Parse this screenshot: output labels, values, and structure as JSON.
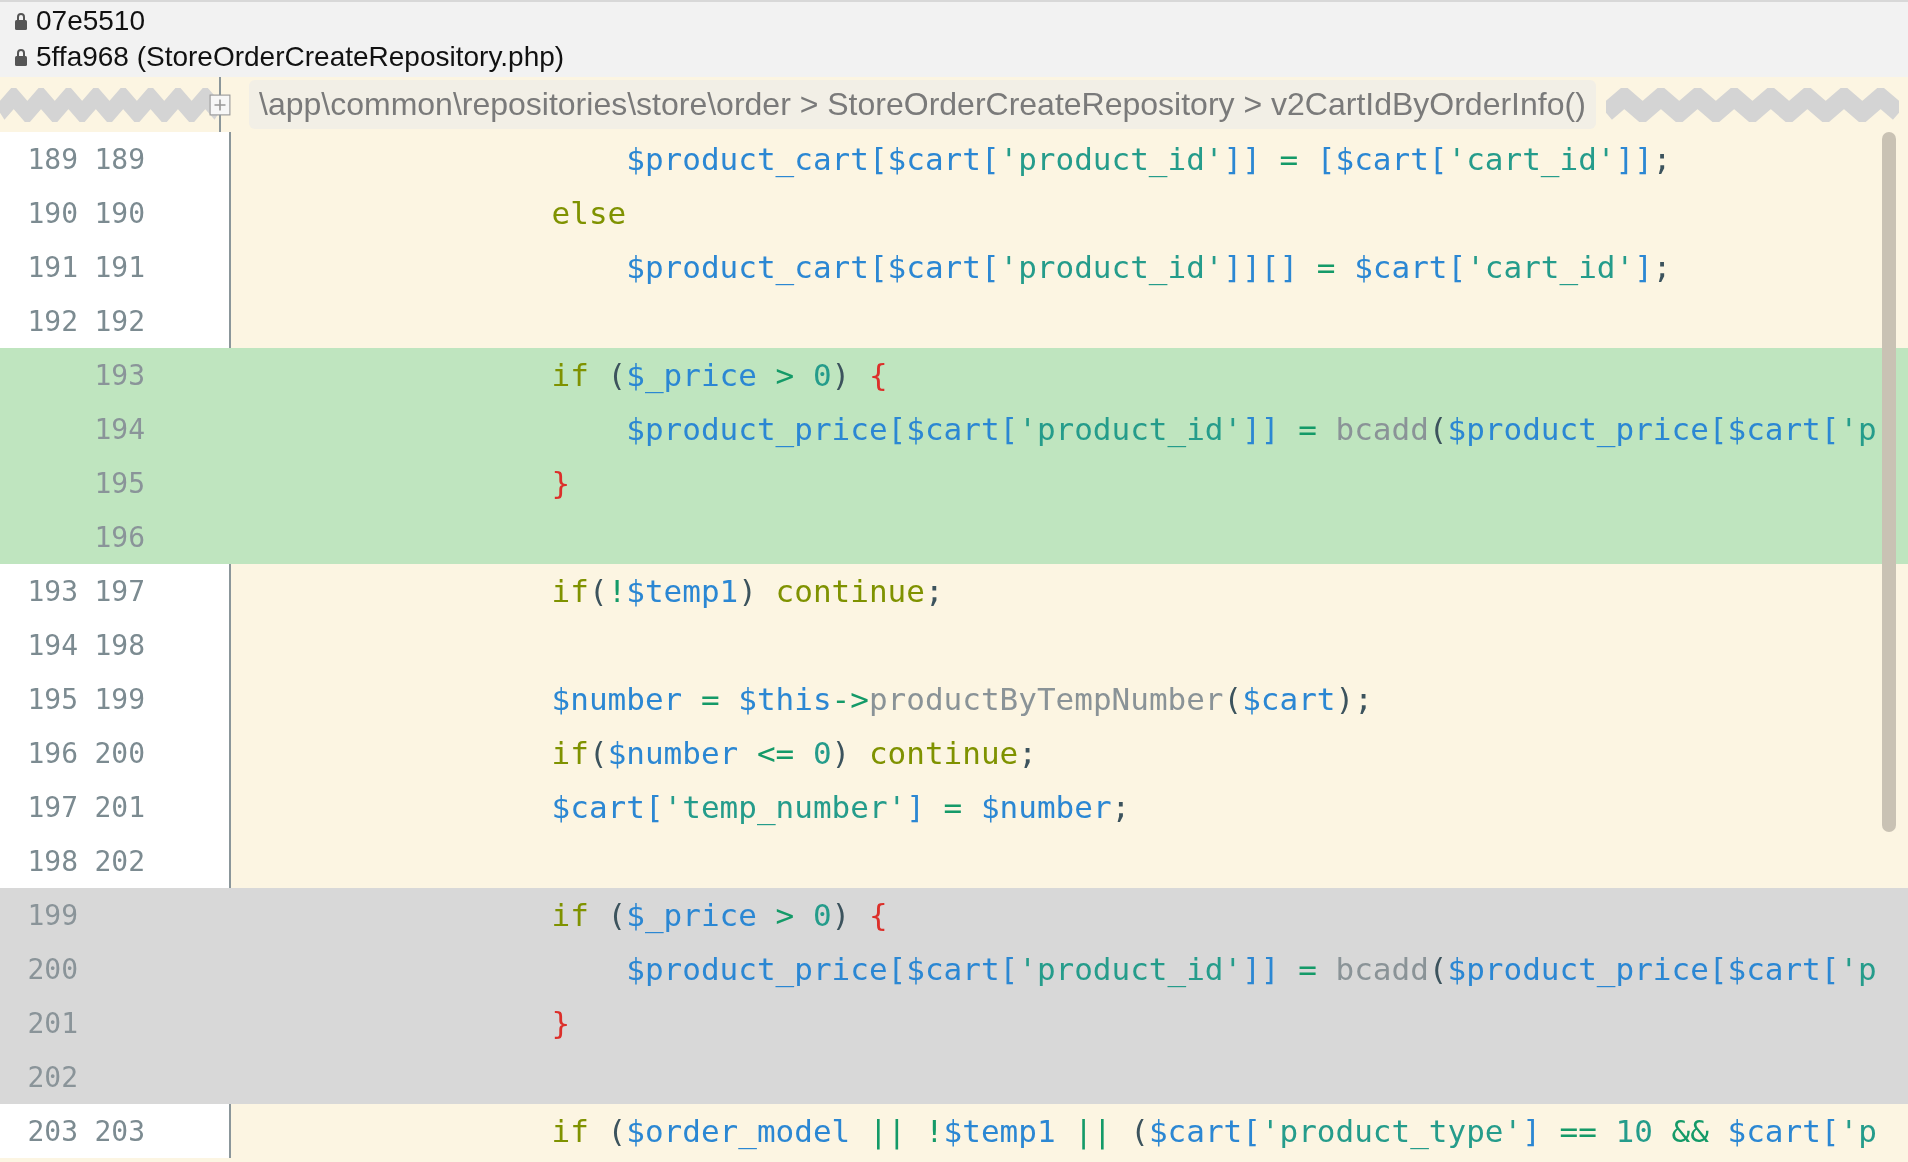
{
  "revisions": [
    {
      "text": "07e5510"
    },
    {
      "text": "5ffa968 (StoreOrderCreateRepository.php)"
    }
  ],
  "breadcrumb": "\\app\\common\\repositories\\store\\order > StoreOrderCreateRepository > v2CartIdByOrderInfo()",
  "lines": [
    {
      "kind": "context",
      "old": "189",
      "new": "189",
      "tokens": [
        {
          "text": "                    $product_cart[$cart[",
          "kind": "var"
        },
        {
          "text": "'product_id'",
          "kind": "str"
        },
        {
          "text": "]]",
          "kind": "var"
        },
        {
          "text": " = ",
          "kind": "op"
        },
        {
          "text": "[$cart[",
          "kind": "var"
        },
        {
          "text": "'cart_id'",
          "kind": "str"
        },
        {
          "text": "]]",
          "kind": "var"
        },
        {
          "text": ";",
          "kind": "punct"
        }
      ]
    },
    {
      "kind": "context",
      "old": "190",
      "new": "190",
      "tokens": [
        {
          "text": "                else",
          "kind": "kw"
        }
      ]
    },
    {
      "kind": "context",
      "old": "191",
      "new": "191",
      "tokens": [
        {
          "text": "                    $product_cart[$cart[",
          "kind": "var"
        },
        {
          "text": "'product_id'",
          "kind": "str"
        },
        {
          "text": "]][]",
          "kind": "var"
        },
        {
          "text": " = ",
          "kind": "op"
        },
        {
          "text": "$cart[",
          "kind": "var"
        },
        {
          "text": "'cart_id'",
          "kind": "str"
        },
        {
          "text": "]",
          "kind": "var"
        },
        {
          "text": ";",
          "kind": "punct"
        }
      ]
    },
    {
      "kind": "context",
      "old": "192",
      "new": "192"
    },
    {
      "kind": "added",
      "new": "193",
      "tokens": [
        {
          "text": "                if",
          "kind": "kw"
        },
        {
          "text": " (",
          "kind": "punct"
        },
        {
          "text": "$_price",
          "kind": "var"
        },
        {
          "text": " > ",
          "kind": "op"
        },
        {
          "text": "0",
          "kind": "num"
        },
        {
          "text": ") ",
          "kind": "punct"
        },
        {
          "text": "{",
          "kind": "brace"
        }
      ]
    },
    {
      "kind": "added",
      "new": "194",
      "tokens": [
        {
          "text": "                    $product_price[$cart[",
          "kind": "var"
        },
        {
          "text": "'product_id'",
          "kind": "str"
        },
        {
          "text": "]]",
          "kind": "var"
        },
        {
          "text": " = ",
          "kind": "op"
        },
        {
          "text": "bcadd",
          "kind": "fn"
        },
        {
          "text": "(",
          "kind": "punct"
        },
        {
          "text": "$product_price[$cart[",
          "kind": "var"
        },
        {
          "text": "'p",
          "kind": "str"
        }
      ]
    },
    {
      "kind": "added",
      "new": "195",
      "tokens": [
        {
          "text": "                }",
          "kind": "brace"
        }
      ]
    },
    {
      "kind": "added",
      "new": "196"
    },
    {
      "kind": "context",
      "old": "193",
      "new": "197",
      "tokens": [
        {
          "text": "                if",
          "kind": "kw"
        },
        {
          "text": "(",
          "kind": "punct"
        },
        {
          "text": "!",
          "kind": "op"
        },
        {
          "text": "$temp1",
          "kind": "var"
        },
        {
          "text": ") ",
          "kind": "punct"
        },
        {
          "text": "continue",
          "kind": "kw"
        },
        {
          "text": ";",
          "kind": "punct"
        }
      ]
    },
    {
      "kind": "context",
      "old": "194",
      "new": "198"
    },
    {
      "kind": "context",
      "old": "195",
      "new": "199",
      "tokens": [
        {
          "text": "                $number",
          "kind": "var"
        },
        {
          "text": " = ",
          "kind": "op"
        },
        {
          "text": "$this",
          "kind": "var"
        },
        {
          "text": "->",
          "kind": "op"
        },
        {
          "text": "productByTempNumber",
          "kind": "fn"
        },
        {
          "text": "(",
          "kind": "punct"
        },
        {
          "text": "$cart",
          "kind": "var"
        },
        {
          "text": ");",
          "kind": "punct"
        }
      ]
    },
    {
      "kind": "context",
      "old": "196",
      "new": "200",
      "tokens": [
        {
          "text": "                if",
          "kind": "kw"
        },
        {
          "text": "(",
          "kind": "punct"
        },
        {
          "text": "$number",
          "kind": "var"
        },
        {
          "text": " <= ",
          "kind": "op"
        },
        {
          "text": "0",
          "kind": "num"
        },
        {
          "text": ") ",
          "kind": "punct"
        },
        {
          "text": "continue",
          "kind": "kw"
        },
        {
          "text": ";",
          "kind": "punct"
        }
      ]
    },
    {
      "kind": "context",
      "old": "197",
      "new": "201",
      "tokens": [
        {
          "text": "                $cart[",
          "kind": "var"
        },
        {
          "text": "'temp_number'",
          "kind": "str"
        },
        {
          "text": "]",
          "kind": "var"
        },
        {
          "text": " = ",
          "kind": "op"
        },
        {
          "text": "$number",
          "kind": "var"
        },
        {
          "text": ";",
          "kind": "punct"
        }
      ]
    },
    {
      "kind": "context",
      "old": "198",
      "new": "202"
    },
    {
      "kind": "removed",
      "old": "199",
      "tokens": [
        {
          "text": "                if",
          "kind": "kw"
        },
        {
          "text": " (",
          "kind": "punct"
        },
        {
          "text": "$_price",
          "kind": "var"
        },
        {
          "text": " > ",
          "kind": "op"
        },
        {
          "text": "0",
          "kind": "num"
        },
        {
          "text": ") ",
          "kind": "punct"
        },
        {
          "text": "{",
          "kind": "brace"
        }
      ]
    },
    {
      "kind": "removed",
      "old": "200",
      "tokens": [
        {
          "text": "                    $product_price[$cart[",
          "kind": "var"
        },
        {
          "text": "'product_id'",
          "kind": "str"
        },
        {
          "text": "]]",
          "kind": "var"
        },
        {
          "text": " = ",
          "kind": "op"
        },
        {
          "text": "bcadd",
          "kind": "fn"
        },
        {
          "text": "(",
          "kind": "punct"
        },
        {
          "text": "$product_price[$cart[",
          "kind": "var"
        },
        {
          "text": "'p",
          "kind": "str"
        }
      ]
    },
    {
      "kind": "removed",
      "old": "201",
      "tokens": [
        {
          "text": "                }",
          "kind": "brace"
        }
      ]
    },
    {
      "kind": "removed",
      "old": "202"
    },
    {
      "kind": "context",
      "old": "203",
      "new": "203",
      "tokens": [
        {
          "text": "                if",
          "kind": "kw"
        },
        {
          "text": " (",
          "kind": "punct"
        },
        {
          "text": "$order_model",
          "kind": "var"
        },
        {
          "text": " || ",
          "kind": "op"
        },
        {
          "text": "!",
          "kind": "op"
        },
        {
          "text": "$temp1",
          "kind": "var"
        },
        {
          "text": " || ",
          "kind": "op"
        },
        {
          "text": "(",
          "kind": "punct"
        },
        {
          "text": "$cart[",
          "kind": "var"
        },
        {
          "text": "'product_type'",
          "kind": "str"
        },
        {
          "text": "]",
          "kind": "var"
        },
        {
          "text": " == ",
          "kind": "op"
        },
        {
          "text": "10",
          "kind": "num"
        },
        {
          "text": " && ",
          "kind": "op"
        },
        {
          "text": "$cart[",
          "kind": "var"
        },
        {
          "text": "'p",
          "kind": "str"
        }
      ]
    }
  ]
}
